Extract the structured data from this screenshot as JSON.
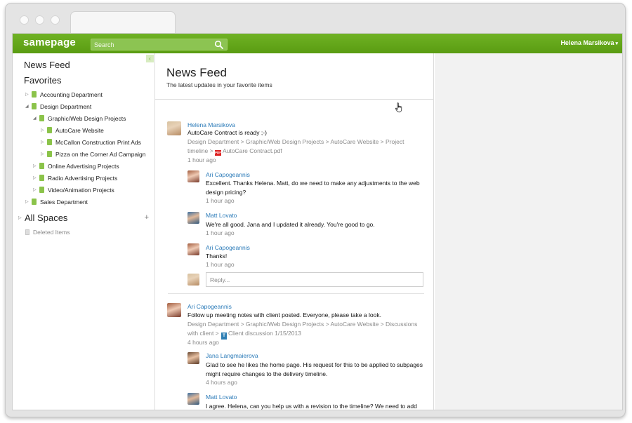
{
  "app": {
    "logo": "samepage",
    "user": "Helena Marsikova"
  },
  "search": {
    "placeholder": "Search"
  },
  "nav": {
    "news_feed": "News Feed",
    "favorites": "Favorites",
    "tree": [
      {
        "label": "Accounting Department",
        "level": 0,
        "expanded": false,
        "name": "accounting-department"
      },
      {
        "label": "Design Department",
        "level": 0,
        "expanded": true,
        "name": "design-department"
      },
      {
        "label": "Graphic/Web Design Projects",
        "level": 1,
        "expanded": true,
        "name": "graphic-web-design-projects"
      },
      {
        "label": "AutoCare Website",
        "level": 2,
        "expanded": false,
        "name": "autocare-website"
      },
      {
        "label": "McCallon Construction Print Ads",
        "level": 2,
        "expanded": false,
        "name": "mccallon-construction-print-ads"
      },
      {
        "label": "Pizza on the Corner Ad Campaign",
        "level": 2,
        "expanded": false,
        "name": "pizza-on-the-corner-ad-campaign"
      },
      {
        "label": "Online Advertising Projects",
        "level": 1,
        "expanded": false,
        "name": "online-advertising-projects"
      },
      {
        "label": "Radio Advertising Projects",
        "level": 1,
        "expanded": false,
        "name": "radio-advertising-projects"
      },
      {
        "label": "Video/Animation Projects",
        "level": 1,
        "expanded": false,
        "name": "video-animation-projects"
      },
      {
        "label": "Sales Department",
        "level": 0,
        "expanded": false,
        "name": "sales-department"
      }
    ],
    "all_spaces": "All Spaces",
    "deleted_items": "Deleted Items"
  },
  "main": {
    "title": "News Feed",
    "subtitle": "The latest updates in your favorite items"
  },
  "feed": {
    "post1": {
      "author": "Helena Marsikova",
      "text": "AutoCare Contract is ready ;-)",
      "path": "Design Department > Graphic/Web Design Projects > AutoCare Website > Project timeline > ",
      "file": "AutoCare Contract.pdf",
      "file_badge": "PDF",
      "time": "1 hour ago",
      "comments": [
        {
          "author": "Ari Capogeannis",
          "text": "Excellent. Thanks Helena. Matt, do we need to make any adjustments to the web design pricing?",
          "time": "1 hour ago"
        },
        {
          "author": "Matt Lovato",
          "text": "We're all good. Jana and I updated it already. You're good to go.",
          "time": "1 hour ago"
        },
        {
          "author": "Ari Capogeannis",
          "text": "Thanks!",
          "time": "1 hour ago"
        }
      ],
      "reply_placeholder": "Reply..."
    },
    "post2": {
      "author": "Ari Capogeannis",
      "text": "Follow up meeting notes with client posted. Everyone, please take a look.",
      "path": "Design Department > Graphic/Web Design Projects > AutoCare Website > Discussions with client > ",
      "doc_badge": "T",
      "file": "Client discussion 1/15/2013",
      "time": "4 hours ago",
      "comments": [
        {
          "author": "Jana Langmaierova",
          "text": "Glad to see he likes the home page. His request for this to be applied to subpages might require changes to the delivery timeline.",
          "time": "4 hours ago"
        },
        {
          "author": "Matt Lovato",
          "text": "I agree. Helena, can you help us with a revision to the timeline? We need to add",
          "time": ""
        }
      ]
    }
  },
  "icons": {
    "search": "magnifier-icon",
    "folder": "folder-icon",
    "pdf": "pdf-icon",
    "document": "document-icon",
    "trash": "trash-icon",
    "add": "plus-icon"
  },
  "colors": {
    "brand_green": "#5ea516",
    "link_blue": "#2a7ab8",
    "folder_green": "#8bc34a",
    "muted_text": "#8a8a8a"
  }
}
